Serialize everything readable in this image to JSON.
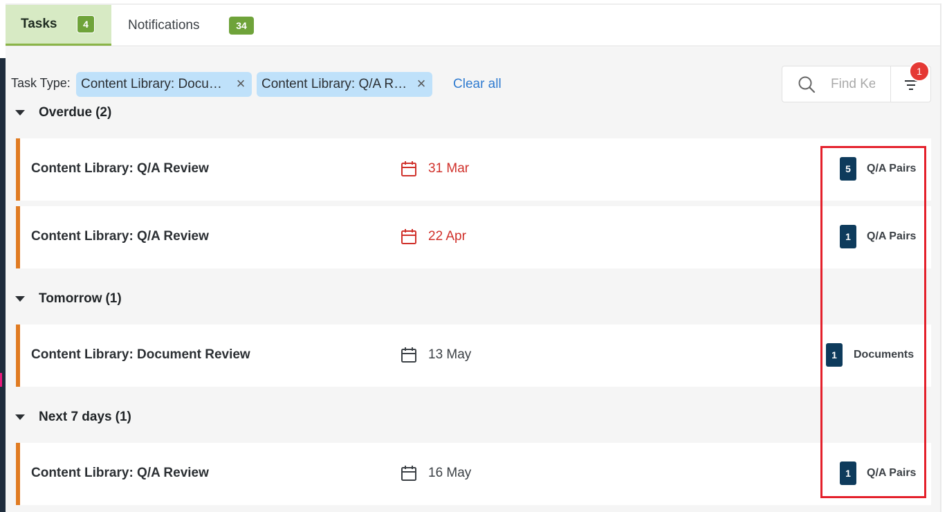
{
  "tabs": [
    {
      "label": "Tasks",
      "count": "4"
    },
    {
      "label": "Notifications",
      "count": "34"
    }
  ],
  "filters": {
    "label": "Task Type:",
    "chips": [
      {
        "label": "Content Library: Document Review"
      },
      {
        "label": "Content Library: Q/A Review"
      }
    ],
    "clear_all": "Clear all"
  },
  "search": {
    "placeholder": "Find Keyword"
  },
  "filter_badge_count": "1",
  "groups": [
    {
      "title": "Overdue",
      "count": "(2)",
      "tasks": [
        {
          "title": "Content Library: Q/A Review",
          "date": "31 Mar",
          "overdue": true,
          "count": "5",
          "count_label": "Q/A Pairs"
        },
        {
          "title": "Content Library: Q/A Review",
          "date": "22 Apr",
          "overdue": true,
          "count": "1",
          "count_label": "Q/A Pairs"
        }
      ]
    },
    {
      "title": "Tomorrow",
      "count": "(1)",
      "tasks": [
        {
          "title": "Content Library: Document Review",
          "date": "13 May",
          "overdue": false,
          "count": "1",
          "count_label": "Documents"
        }
      ]
    },
    {
      "title": "Next 7 days",
      "count": "(1)",
      "tasks": [
        {
          "title": "Content Library: Q/A Review",
          "date": "16 May",
          "overdue": false,
          "count": "1",
          "count_label": "Q/A Pairs"
        }
      ]
    }
  ],
  "colors": {
    "active_tab_bg": "#d7eac4",
    "tab_count_bg": "#6fa33a",
    "chip_bg": "#bfe1fa",
    "link": "#2f7bd0",
    "overdue": "#d0302a",
    "task_accent": "#e07b22",
    "count_badge_bg": "#0e3b5c",
    "filter_badge_bg": "#e53935",
    "highlight": "#e4202b"
  }
}
